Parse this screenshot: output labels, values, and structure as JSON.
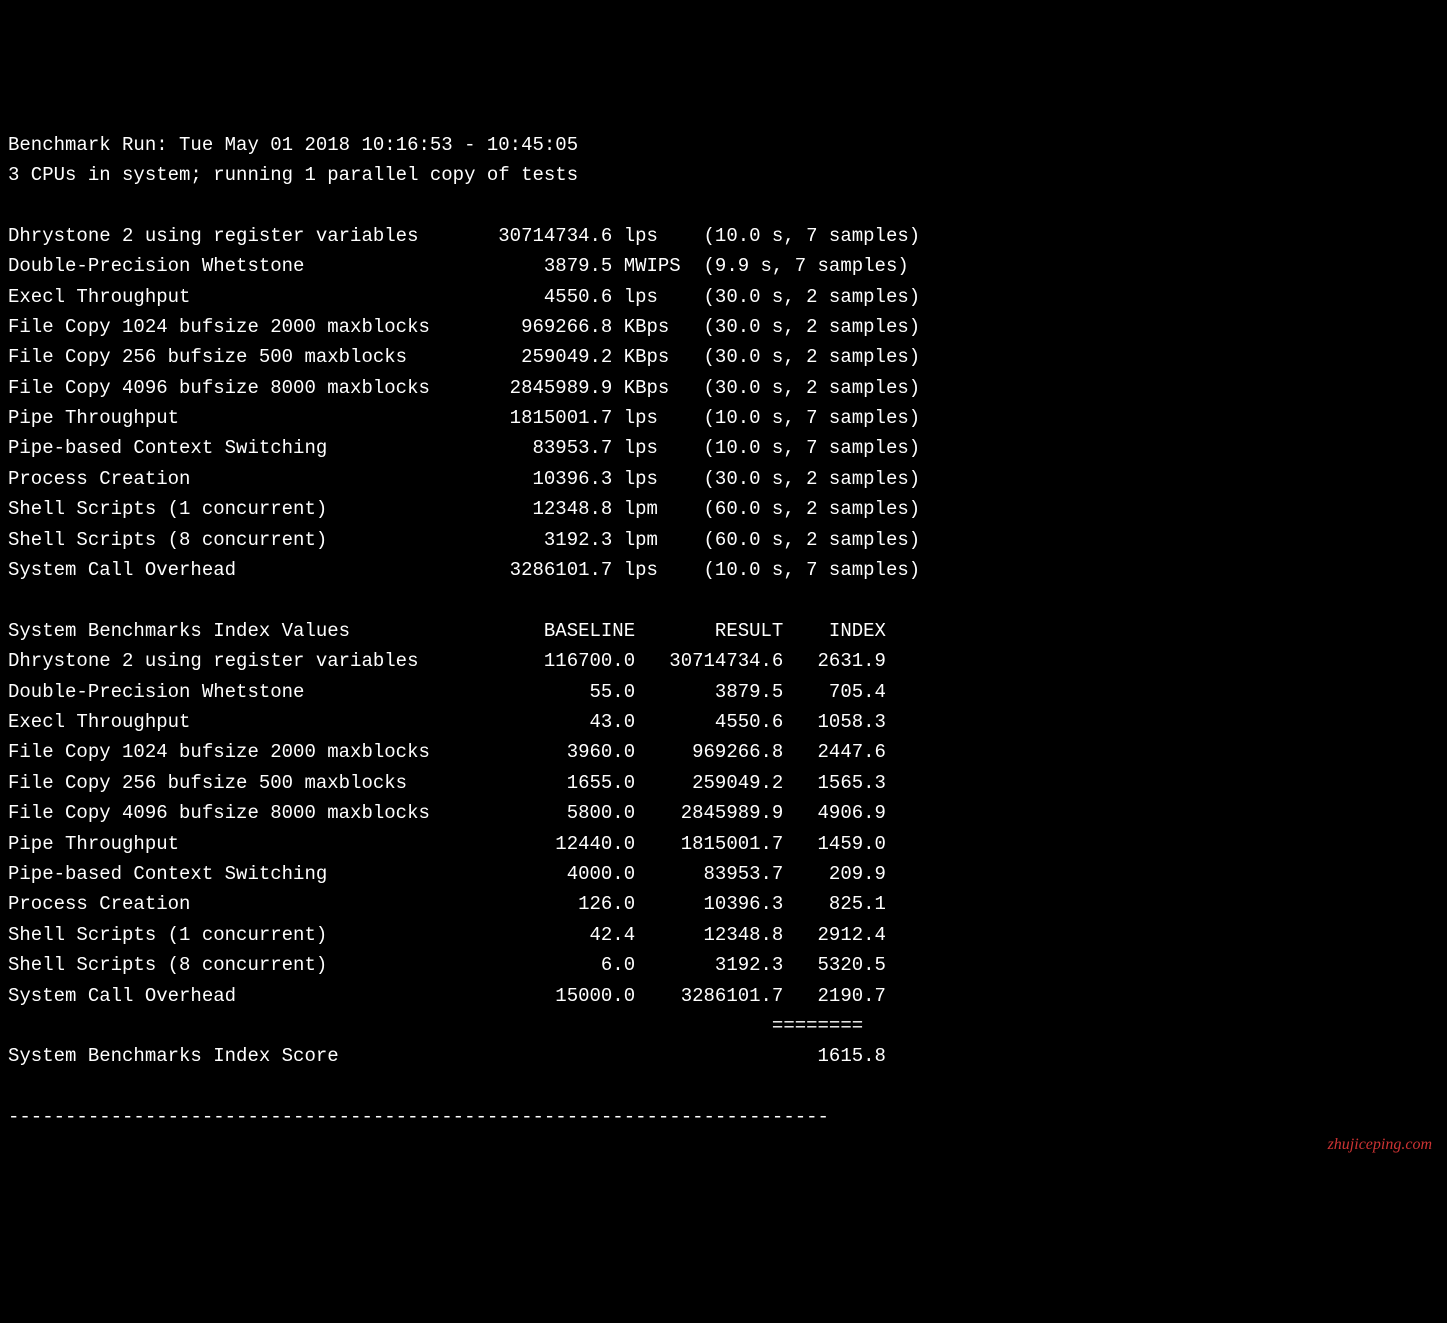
{
  "header": {
    "run_time": "Benchmark Run: Tue May 01 2018 10:16:53 - 10:45:05",
    "cpu_info": "3 CPUs in system; running 1 parallel copy of tests"
  },
  "tests": [
    {
      "name": "Dhrystone 2 using register variables",
      "value": "30714734.6",
      "unit": "lps",
      "timing": "(10.0 s, 7 samples)"
    },
    {
      "name": "Double-Precision Whetstone",
      "value": "3879.5",
      "unit": "MWIPS",
      "timing": "(9.9 s, 7 samples)"
    },
    {
      "name": "Execl Throughput",
      "value": "4550.6",
      "unit": "lps",
      "timing": "(30.0 s, 2 samples)"
    },
    {
      "name": "File Copy 1024 bufsize 2000 maxblocks",
      "value": "969266.8",
      "unit": "KBps",
      "timing": "(30.0 s, 2 samples)"
    },
    {
      "name": "File Copy 256 bufsize 500 maxblocks",
      "value": "259049.2",
      "unit": "KBps",
      "timing": "(30.0 s, 2 samples)"
    },
    {
      "name": "File Copy 4096 bufsize 8000 maxblocks",
      "value": "2845989.9",
      "unit": "KBps",
      "timing": "(30.0 s, 2 samples)"
    },
    {
      "name": "Pipe Throughput",
      "value": "1815001.7",
      "unit": "lps",
      "timing": "(10.0 s, 7 samples)"
    },
    {
      "name": "Pipe-based Context Switching",
      "value": "83953.7",
      "unit": "lps",
      "timing": "(10.0 s, 7 samples)"
    },
    {
      "name": "Process Creation",
      "value": "10396.3",
      "unit": "lps",
      "timing": "(30.0 s, 2 samples)"
    },
    {
      "name": "Shell Scripts (1 concurrent)",
      "value": "12348.8",
      "unit": "lpm",
      "timing": "(60.0 s, 2 samples)"
    },
    {
      "name": "Shell Scripts (8 concurrent)",
      "value": "3192.3",
      "unit": "lpm",
      "timing": "(60.0 s, 2 samples)"
    },
    {
      "name": "System Call Overhead",
      "value": "3286101.7",
      "unit": "lps",
      "timing": "(10.0 s, 7 samples)"
    }
  ],
  "index_header": {
    "title": "System Benchmarks Index Values",
    "col1": "BASELINE",
    "col2": "RESULT",
    "col3": "INDEX"
  },
  "index_rows": [
    {
      "name": "Dhrystone 2 using register variables",
      "baseline": "116700.0",
      "result": "30714734.6",
      "index": "2631.9"
    },
    {
      "name": "Double-Precision Whetstone",
      "baseline": "55.0",
      "result": "3879.5",
      "index": "705.4"
    },
    {
      "name": "Execl Throughput",
      "baseline": "43.0",
      "result": "4550.6",
      "index": "1058.3"
    },
    {
      "name": "File Copy 1024 bufsize 2000 maxblocks",
      "baseline": "3960.0",
      "result": "969266.8",
      "index": "2447.6"
    },
    {
      "name": "File Copy 256 bufsize 500 maxblocks",
      "baseline": "1655.0",
      "result": "259049.2",
      "index": "1565.3"
    },
    {
      "name": "File Copy 4096 bufsize 8000 maxblocks",
      "baseline": "5800.0",
      "result": "2845989.9",
      "index": "4906.9"
    },
    {
      "name": "Pipe Throughput",
      "baseline": "12440.0",
      "result": "1815001.7",
      "index": "1459.0"
    },
    {
      "name": "Pipe-based Context Switching",
      "baseline": "4000.0",
      "result": "83953.7",
      "index": "209.9"
    },
    {
      "name": "Process Creation",
      "baseline": "126.0",
      "result": "10396.3",
      "index": "825.1"
    },
    {
      "name": "Shell Scripts (1 concurrent)",
      "baseline": "42.4",
      "result": "12348.8",
      "index": "2912.4"
    },
    {
      "name": "Shell Scripts (8 concurrent)",
      "baseline": "6.0",
      "result": "3192.3",
      "index": "5320.5"
    },
    {
      "name": "System Call Overhead",
      "baseline": "15000.0",
      "result": "3286101.7",
      "index": "2190.7"
    }
  ],
  "score": {
    "divider": "                                                                   ========",
    "label": "System Benchmarks Index Score",
    "value": "1615.8"
  },
  "hr": "------------------------------------------------------------------------",
  "watermark": "zhujiceping.com"
}
